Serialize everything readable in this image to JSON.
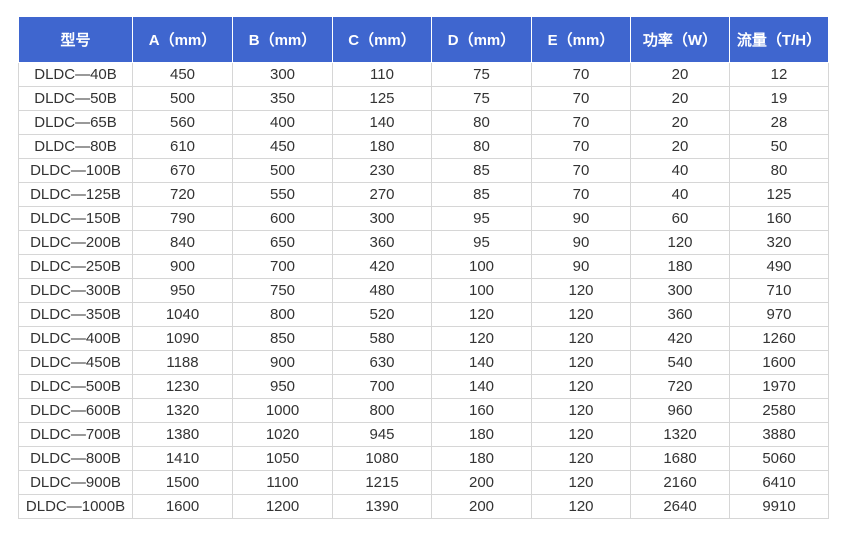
{
  "table": {
    "headers": [
      "型号",
      "A（mm）",
      "B（mm）",
      "C（mm）",
      "D（mm）",
      "E（mm）",
      "功率（W）",
      "流量（T/H）"
    ],
    "rows": [
      [
        "DLDC—40B",
        "450",
        "300",
        "110",
        "75",
        "70",
        "20",
        "12"
      ],
      [
        "DLDC—50B",
        "500",
        "350",
        "125",
        "75",
        "70",
        "20",
        "19"
      ],
      [
        "DLDC—65B",
        "560",
        "400",
        "140",
        "80",
        "70",
        "20",
        "28"
      ],
      [
        "DLDC—80B",
        "610",
        "450",
        "180",
        "80",
        "70",
        "20",
        "50"
      ],
      [
        "DLDC—100B",
        "670",
        "500",
        "230",
        "85",
        "70",
        "40",
        "80"
      ],
      [
        "DLDC—125B",
        "720",
        "550",
        "270",
        "85",
        "70",
        "40",
        "125"
      ],
      [
        "DLDC—150B",
        "790",
        "600",
        "300",
        "95",
        "90",
        "60",
        "160"
      ],
      [
        "DLDC—200B",
        "840",
        "650",
        "360",
        "95",
        "90",
        "120",
        "320"
      ],
      [
        "DLDC—250B",
        "900",
        "700",
        "420",
        "100",
        "90",
        "180",
        "490"
      ],
      [
        "DLDC—300B",
        "950",
        "750",
        "480",
        "100",
        "120",
        "300",
        "710"
      ],
      [
        "DLDC—350B",
        "1040",
        "800",
        "520",
        "120",
        "120",
        "360",
        "970"
      ],
      [
        "DLDC—400B",
        "1090",
        "850",
        "580",
        "120",
        "120",
        "420",
        "1260"
      ],
      [
        "DLDC—450B",
        "1188",
        "900",
        "630",
        "140",
        "120",
        "540",
        "1600"
      ],
      [
        "DLDC—500B",
        "1230",
        "950",
        "700",
        "140",
        "120",
        "720",
        "1970"
      ],
      [
        "DLDC—600B",
        "1320",
        "1000",
        "800",
        "160",
        "120",
        "960",
        "2580"
      ],
      [
        "DLDC—700B",
        "1380",
        "1020",
        "945",
        "180",
        "120",
        "1320",
        "3880"
      ],
      [
        "DLDC—800B",
        "1410",
        "1050",
        "1080",
        "180",
        "120",
        "1680",
        "5060"
      ],
      [
        "DLDC—900B",
        "1500",
        "1100",
        "1215",
        "200",
        "120",
        "2160",
        "6410"
      ],
      [
        "DLDC—1000B",
        "1600",
        "1200",
        "1390",
        "200",
        "120",
        "2640",
        "9910"
      ]
    ]
  },
  "colors": {
    "header_background": "#3f66cf",
    "header_text": "#ffffff",
    "cell_text": "#333333",
    "grid_line": "#d6d6d6"
  }
}
